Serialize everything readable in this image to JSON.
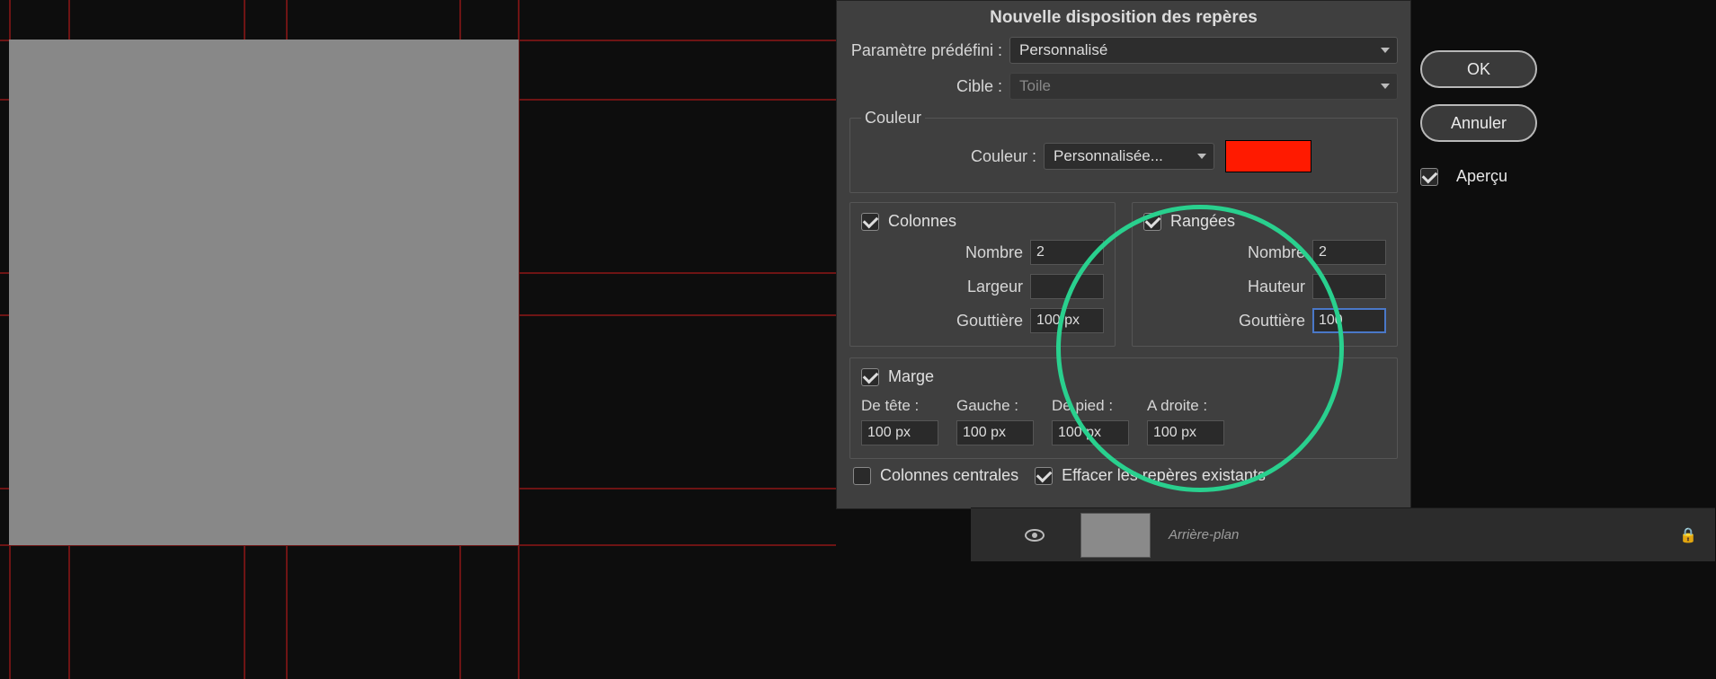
{
  "dialog": {
    "title": "Nouvelle disposition des repères",
    "preset_label": "Paramètre prédéfini :",
    "preset_value": "Personnalisé",
    "target_label": "Cible :",
    "target_value": "Toile",
    "color_group_label": "Couleur",
    "color_label": "Couleur :",
    "color_value": "Personnalisée...",
    "color_hex": "#ff1a00",
    "columns": {
      "title": "Colonnes",
      "checked": true,
      "number_label": "Nombre",
      "number_value": "2",
      "width_label": "Largeur",
      "width_value": "",
      "gutter_label": "Gouttière",
      "gutter_value": "100 px"
    },
    "rows": {
      "title": "Rangées",
      "checked": true,
      "number_label": "Nombre",
      "number_value": "2",
      "height_label": "Hauteur",
      "height_value": "",
      "gutter_label": "Gouttière",
      "gutter_value": "100"
    },
    "margin": {
      "title": "Marge",
      "checked": true,
      "top_label": "De tête :",
      "left_label": "Gauche :",
      "bottom_label": "De pied :",
      "right_label": "A droite :",
      "top_value": "100 px",
      "left_value": "100 px",
      "bottom_value": "100 px",
      "right_value": "100 px"
    },
    "center_columns_label": "Colonnes centrales",
    "center_columns_checked": false,
    "clear_guides_label": "Effacer les repères existants",
    "clear_guides_checked": true
  },
  "buttons": {
    "ok": "OK",
    "cancel": "Annuler",
    "preview": "Aperçu",
    "preview_checked": true
  },
  "layers": {
    "name": "Arrière-plan"
  }
}
